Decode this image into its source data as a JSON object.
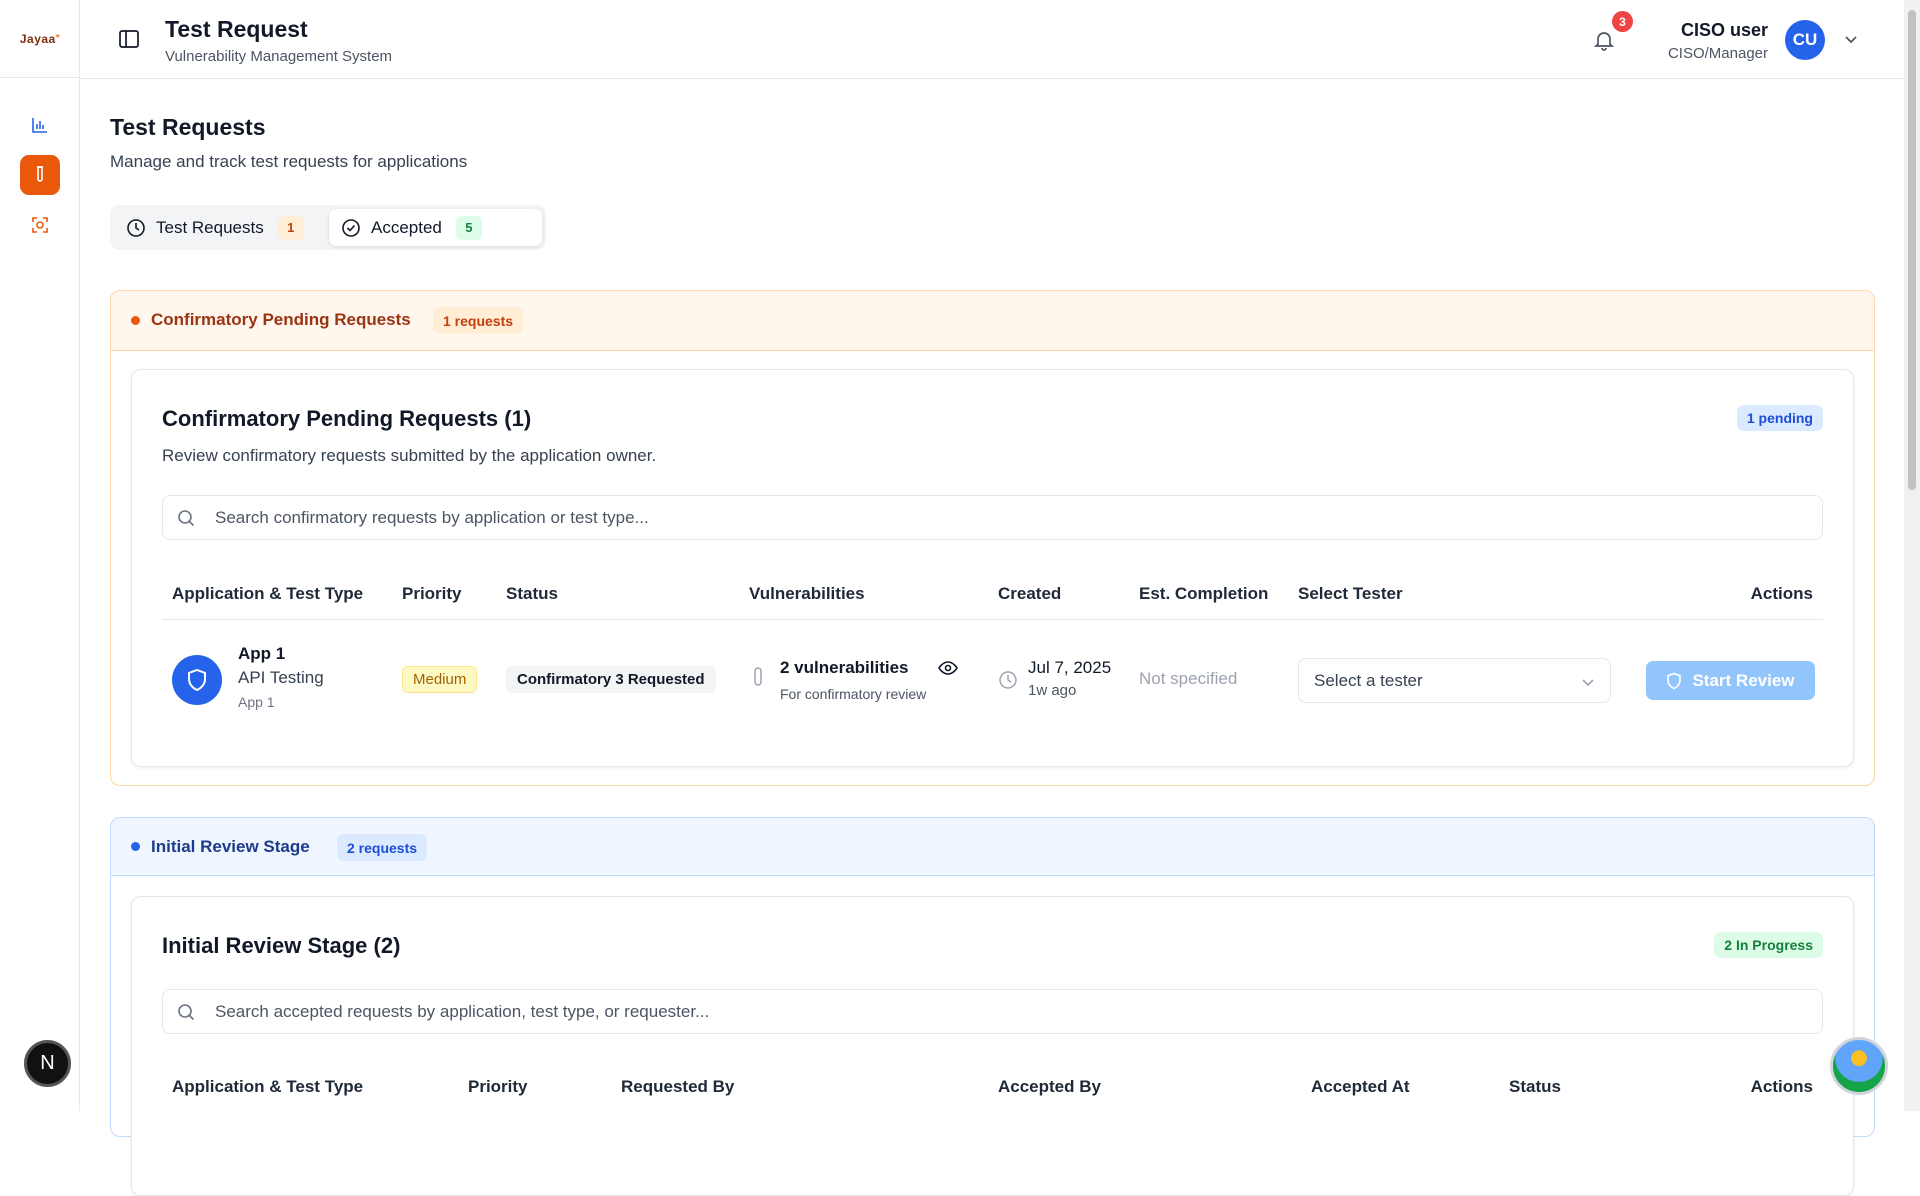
{
  "sidebar": {
    "logo": "Jayaa",
    "nav": [
      "analytics-icon",
      "flask-icon",
      "scan-icon"
    ],
    "footer_avatar": "N"
  },
  "header": {
    "title": "Test Request",
    "subtitle": "Vulnerability Management System",
    "notification_count": "3",
    "user_name": "CISO user",
    "user_role": "CISO/Manager",
    "user_initials": "CU"
  },
  "page": {
    "title": "Test Requests",
    "subtitle": "Manage and track test requests for applications"
  },
  "tabs": [
    {
      "label": "Test Requests",
      "count": "1"
    },
    {
      "label": "Accepted",
      "count": "5"
    }
  ],
  "confirmatory": {
    "section_label": "Confirmatory Pending Requests",
    "section_pill": "1 requests",
    "card_title": "Confirmatory Pending Requests (1)",
    "card_sub": "Review confirmatory requests submitted by the application owner.",
    "card_pill": "1 pending",
    "search_placeholder": "Search confirmatory requests by application or test type...",
    "columns": [
      "Application & Test Type",
      "Priority",
      "Status",
      "Vulnerabilities",
      "Created",
      "Est. Completion",
      "Select Tester",
      "Actions"
    ],
    "row": {
      "app_name": "App 1",
      "test_type": "API Testing",
      "app_sub": "App 1",
      "priority": "Medium",
      "status": "Confirmatory 3 Requested",
      "vuln_count": "2 vulnerabilities",
      "vuln_sub": "For confirmatory review",
      "created_date": "Jul 7, 2025",
      "created_ago": "1w ago",
      "est_completion": "Not specified",
      "tester_placeholder": "Select a tester",
      "action": "Start Review"
    }
  },
  "initial_review": {
    "section_label": "Initial Review Stage",
    "section_pill": "2 requests",
    "card_title": "Initial Review Stage (2)",
    "card_pill": "2 In Progress",
    "search_placeholder": "Search accepted requests by application, test type, or requester...",
    "columns": [
      "Application & Test Type",
      "Priority",
      "Requested By",
      "Accepted By",
      "Accepted At",
      "Status",
      "Actions"
    ]
  },
  "colors": {
    "accent_orange": "#ea580c",
    "primary_blue": "#2563eb",
    "danger": "#ef4444"
  }
}
